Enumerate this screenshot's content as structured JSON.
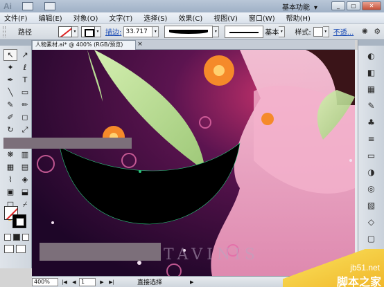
{
  "app": {
    "logo": "Ai",
    "workspace": "基本功能"
  },
  "window_buttons": [
    "_",
    "▢",
    "✕"
  ],
  "menu": [
    "文件(F)",
    "编辑(E)",
    "对象(O)",
    "文字(T)",
    "选择(S)",
    "效果(C)",
    "视图(V)",
    "窗口(W)",
    "帮助(H)"
  ],
  "control": {
    "selection_type": "路径",
    "stroke_link": "描边:",
    "stroke_weight": "33.717",
    "brush_label": "基本",
    "style_label": "样式:",
    "opacity_link": "不透..."
  },
  "document": {
    "tab_title": "人物素材.ai* @ 400% (RGB/预览)",
    "close": "×"
  },
  "tools": [
    {
      "name": "selection-tool",
      "glyph": "↖"
    },
    {
      "name": "direct-selection-tool",
      "glyph": "↗"
    },
    {
      "name": "magic-wand-tool",
      "glyph": "✦"
    },
    {
      "name": "lasso-tool",
      "glyph": "ℓ"
    },
    {
      "name": "pen-tool",
      "glyph": "✒"
    },
    {
      "name": "type-tool",
      "glyph": "T"
    },
    {
      "name": "line-tool",
      "glyph": "╲"
    },
    {
      "name": "rectangle-tool",
      "glyph": "▭"
    },
    {
      "name": "paintbrush-tool",
      "glyph": "✎"
    },
    {
      "name": "pencil-tool",
      "glyph": "✏"
    },
    {
      "name": "blob-brush-tool",
      "glyph": "✐"
    },
    {
      "name": "eraser-tool",
      "glyph": "◻"
    },
    {
      "name": "rotate-tool",
      "glyph": "↻"
    },
    {
      "name": "scale-tool",
      "glyph": "⤢"
    },
    {
      "name": "warp-tool",
      "glyph": "≈"
    },
    {
      "name": "free-transform-tool",
      "glyph": "⬚"
    },
    {
      "name": "symbol-sprayer-tool",
      "glyph": "❋"
    },
    {
      "name": "graph-tool",
      "glyph": "▥"
    },
    {
      "name": "mesh-tool",
      "glyph": "▦"
    },
    {
      "name": "gradient-tool",
      "glyph": "▤"
    },
    {
      "name": "eyedropper-tool",
      "glyph": "⌇"
    },
    {
      "name": "blend-tool",
      "glyph": "◈"
    },
    {
      "name": "live-paint-tool",
      "glyph": "▣"
    },
    {
      "name": "live-paint-selection-tool",
      "glyph": "⬓"
    },
    {
      "name": "artboard-tool",
      "glyph": "□"
    },
    {
      "name": "slice-tool",
      "glyph": "⌿"
    },
    {
      "name": "hand-tool",
      "glyph": "✋"
    },
    {
      "name": "zoom-tool",
      "glyph": "⌕"
    }
  ],
  "right_panel_icons": [
    {
      "name": "color-panel-icon",
      "glyph": "◐"
    },
    {
      "name": "color-guide-icon",
      "glyph": "◧"
    },
    {
      "name": "swatches-icon",
      "glyph": "▦"
    },
    {
      "name": "brushes-icon",
      "glyph": "✎"
    },
    {
      "name": "symbols-icon",
      "glyph": "♣"
    },
    {
      "name": "stroke-panel-icon",
      "glyph": "≡"
    },
    {
      "name": "gradient-panel-icon",
      "glyph": "▭"
    },
    {
      "name": "transparency-icon",
      "glyph": "◑"
    },
    {
      "name": "appearance-icon",
      "glyph": "◎"
    },
    {
      "name": "graphic-styles-icon",
      "glyph": "▧"
    },
    {
      "name": "layers-icon",
      "glyph": "◇"
    },
    {
      "name": "artboards-icon",
      "glyph": "▢"
    }
  ],
  "status": {
    "zoom": "400%",
    "page": "1",
    "tool": "直接选择"
  },
  "canvas_text": "TAVINIS",
  "watermark": {
    "site": "jb51.net",
    "brand": "脚本之家"
  }
}
